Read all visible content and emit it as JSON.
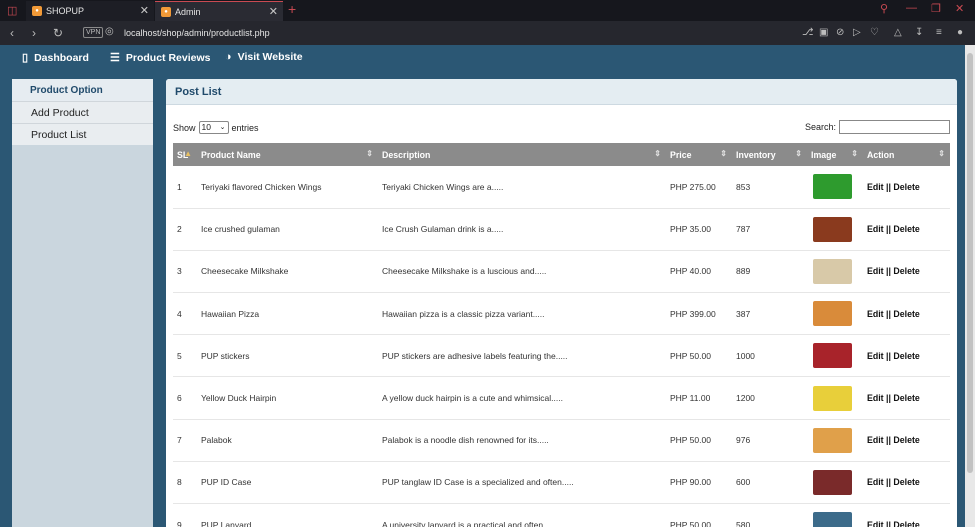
{
  "browser": {
    "tabs": [
      {
        "favicon": "store-icon",
        "label": "SHOPUP"
      },
      {
        "favicon": "store-icon",
        "label": "Admin"
      }
    ],
    "vpn_label": "VPN",
    "url": "localhost/shop/admin/productlist.php"
  },
  "nav": {
    "items": [
      {
        "icon": "bar-chart-icon",
        "label": "Dashboard"
      },
      {
        "icon": "list-icon",
        "label": "Product Reviews"
      },
      {
        "icon": "globe-icon",
        "label": "Visit Website"
      }
    ]
  },
  "sidebar": {
    "heading": "Product Option",
    "links": [
      "Add Product",
      "Product List"
    ]
  },
  "panel": {
    "title": "Post List",
    "show_prefix": "Show",
    "show_value": "10",
    "show_suffix": "entries",
    "search_label": "Search:",
    "search_value": ""
  },
  "table": {
    "columns": [
      "SL",
      "Product Name",
      "Description",
      "Price",
      "Inventory",
      "Image",
      "Action"
    ],
    "action_text": "Edit || Delete",
    "rows": [
      {
        "sl": "1",
        "name": "Teriyaki flavored Chicken Wings",
        "desc": "Teriyaki Chicken Wings are a.....",
        "price": "PHP 275.00",
        "inventory": "853",
        "image_color": "#2e9b2e"
      },
      {
        "sl": "2",
        "name": "Ice crushed gulaman",
        "desc": "Ice Crush Gulaman drink is a.....",
        "price": "PHP 35.00",
        "inventory": "787",
        "image_color": "#8a3a1e"
      },
      {
        "sl": "3",
        "name": "Cheesecake Milkshake",
        "desc": "Cheesecake Milkshake is a luscious and.....",
        "price": "PHP 40.00",
        "inventory": "889",
        "image_color": "#d8c9a8"
      },
      {
        "sl": "4",
        "name": "Hawaiian Pizza",
        "desc": "Hawaiian pizza is a classic pizza variant.....",
        "price": "PHP 399.00",
        "inventory": "387",
        "image_color": "#d98b3a"
      },
      {
        "sl": "5",
        "name": "PUP stickers",
        "desc": "PUP stickers are adhesive labels featuring the.....",
        "price": "PHP 50.00",
        "inventory": "1000",
        "image_color": "#a8232a"
      },
      {
        "sl": "6",
        "name": "Yellow Duck Hairpin",
        "desc": "A yellow duck hairpin is a cute and whimsical.....",
        "price": "PHP 11.00",
        "inventory": "1200",
        "image_color": "#e8cf3a"
      },
      {
        "sl": "7",
        "name": "Palabok",
        "desc": "Palabok is a noodle dish renowned for its.....",
        "price": "PHP 50.00",
        "inventory": "976",
        "image_color": "#e0a04a"
      },
      {
        "sl": "8",
        "name": "PUP ID Case",
        "desc": "PUP tanglaw ID Case is a specialized and often.....",
        "price": "PHP 90.00",
        "inventory": "600",
        "image_color": "#7a2a2a"
      },
      {
        "sl": "9",
        "name": "PUP Lanyard",
        "desc": "A university lanyard is a practical and often.....",
        "price": "PHP 50.00",
        "inventory": "580",
        "image_color": "#3c6b8a"
      }
    ]
  },
  "colors": {
    "nav_bg": "#2b5774",
    "header_bg": "#8b8b8b",
    "accent": "#c94a52"
  }
}
